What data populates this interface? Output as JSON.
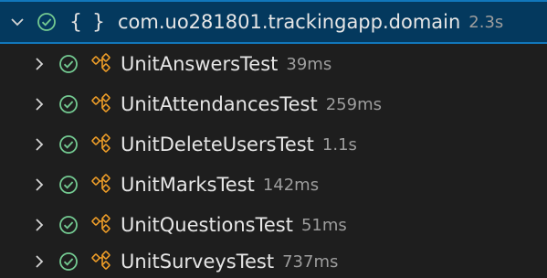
{
  "root": {
    "label": "com.uo281801.trackingapp.domain",
    "duration": "2.3s",
    "braces": "{ }",
    "expand_icon": "chevron-down-icon",
    "status_icon": "pass-check-icon"
  },
  "tests": [
    {
      "label": "UnitAnswersTest",
      "duration": "39ms"
    },
    {
      "label": "UnitAttendancesTest",
      "duration": "259ms"
    },
    {
      "label": "UnitDeleteUsersTest",
      "duration": "1.1s"
    },
    {
      "label": "UnitMarksTest",
      "duration": "142ms"
    },
    {
      "label": "UnitQuestionsTest",
      "duration": "51ms"
    },
    {
      "label": "UnitSurveysTest",
      "duration": "737ms"
    }
  ],
  "colors": {
    "pass": "#73c991",
    "class_icon": "#ee9d28",
    "selection_bg": "#04395e",
    "selection_border": "#1177bb"
  }
}
